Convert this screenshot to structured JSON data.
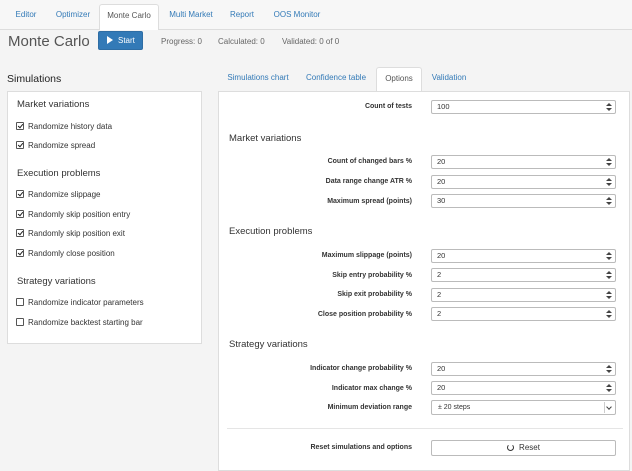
{
  "nav": {
    "tabs": [
      {
        "label": "Editor"
      },
      {
        "label": "Optimizer"
      },
      {
        "label": "Monte Carlo"
      },
      {
        "label": "Multi Market"
      },
      {
        "label": "Report"
      },
      {
        "label": "OOS Monitor"
      }
    ],
    "active": "Monte Carlo"
  },
  "header": {
    "title": "Monte Carlo",
    "start_label": "Start",
    "progress": "Progress: 0",
    "calculated": "Calculated: 0",
    "validated": "Validated: 0 of 0"
  },
  "simulations": {
    "heading": "Simulations",
    "groups": [
      {
        "title": "Market variations",
        "items": [
          {
            "label": "Randomize history data",
            "checked": true
          },
          {
            "label": "Randomize spread",
            "checked": true
          }
        ]
      },
      {
        "title": "Execution problems",
        "items": [
          {
            "label": "Randomize slippage",
            "checked": true
          },
          {
            "label": "Randomly skip position entry",
            "checked": true
          },
          {
            "label": "Randomly skip position exit",
            "checked": true
          },
          {
            "label": "Randomly close position",
            "checked": true
          }
        ]
      },
      {
        "title": "Strategy variations",
        "items": [
          {
            "label": "Randomize indicator parameters",
            "checked": false
          },
          {
            "label": "Randomize backtest starting bar",
            "checked": false
          }
        ]
      }
    ]
  },
  "right_tabs": [
    {
      "label": "Simulations chart"
    },
    {
      "label": "Confidence table"
    },
    {
      "label": "Options"
    },
    {
      "label": "Validation"
    }
  ],
  "options": {
    "count_of_tests": {
      "label": "Count of tests",
      "value": "100"
    },
    "market_variations": {
      "title": "Market variations",
      "fields": [
        {
          "label": "Count of changed bars %",
          "value": "20"
        },
        {
          "label": "Data range change ATR %",
          "value": "20"
        },
        {
          "label": "Maximum spread (points)",
          "value": "30"
        }
      ]
    },
    "execution_problems": {
      "title": "Execution problems",
      "fields": [
        {
          "label": "Maximum slippage (points)",
          "value": "20"
        },
        {
          "label": "Skip entry probability %",
          "value": "2"
        },
        {
          "label": "Skip exit probability %",
          "value": "2"
        },
        {
          "label": "Close position probability %",
          "value": "2"
        }
      ]
    },
    "strategy_variations": {
      "title": "Strategy variations",
      "fields": [
        {
          "label": "Indicator change probability %",
          "value": "20"
        },
        {
          "label": "Indicator max change %",
          "value": "20"
        }
      ],
      "min_deviation": {
        "label": "Minimum deviation range",
        "value": "± 20 steps"
      }
    },
    "reset": {
      "label": "Reset simulations and options",
      "button": "Reset"
    }
  }
}
